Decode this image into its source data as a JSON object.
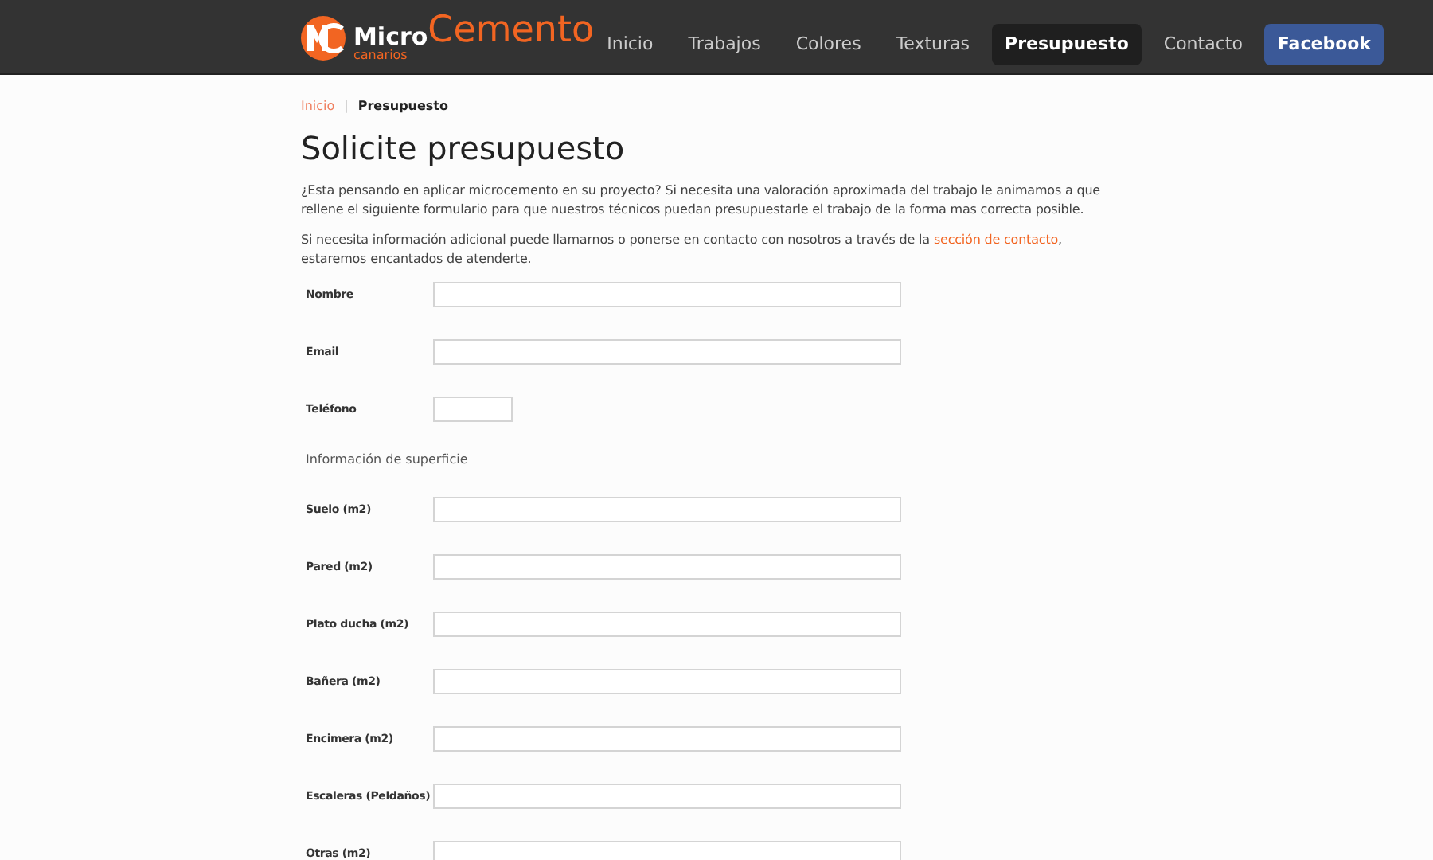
{
  "logo": {
    "micro": "Micro",
    "cemento": "Cemento",
    "canarios": "canarios"
  },
  "nav": [
    {
      "label": "Inicio",
      "selected": false,
      "kind": "link"
    },
    {
      "label": "Trabajos",
      "selected": false,
      "kind": "link"
    },
    {
      "label": "Colores",
      "selected": false,
      "kind": "link"
    },
    {
      "label": "Texturas",
      "selected": false,
      "kind": "link"
    },
    {
      "label": "Presupuesto",
      "selected": true,
      "kind": "link"
    },
    {
      "label": "Contacto",
      "selected": false,
      "kind": "link"
    },
    {
      "label": "Facebook",
      "selected": false,
      "kind": "social"
    }
  ],
  "breadcrumb": {
    "home": "Inicio",
    "separator": "|",
    "current": "Presupuesto"
  },
  "title": "Solicite presupuesto",
  "intro": "¿Esta pensando en aplicar microcemento en su proyecto? Si necesita una valoración aproximada del trabajo le animamos a que rellene el siguiente formulario para que nuestros técnicos puedan presupuestarle el trabajo de la forma mas correcta posible.",
  "contact_note": {
    "before": "Si necesita información adicional puede llamarnos o ponerse en contacto con nosotros a través de la",
    "link": "sección de contacto",
    "after": ", estaremos encantados de atenderte."
  },
  "form": [
    {
      "kind": "wide",
      "label": "Nombre"
    },
    {
      "kind": "wide",
      "label": "Email"
    },
    {
      "kind": "short",
      "label": "Teléfono"
    },
    {
      "kind": "section",
      "label": "Información de superficie"
    },
    {
      "kind": "wide",
      "label": "Suelo (m2)"
    },
    {
      "kind": "wide",
      "label": "Pared (m2)"
    },
    {
      "kind": "wide",
      "label": "Plato ducha (m2)"
    },
    {
      "kind": "wide",
      "label": "Bañera (m2)"
    },
    {
      "kind": "wide",
      "label": "Encimera (m2)"
    },
    {
      "kind": "wide",
      "label": "Escaleras (Peldaños)"
    },
    {
      "kind": "wide",
      "label": "Otras (m2)"
    }
  ]
}
